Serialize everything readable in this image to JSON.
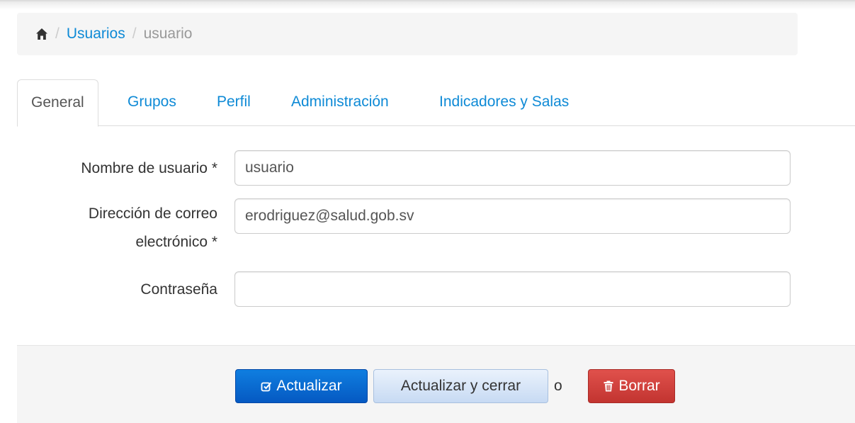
{
  "breadcrumb": {
    "home_icon": "home-icon",
    "items": [
      "Usuarios",
      "usuario"
    ],
    "separator": "/"
  },
  "tabs": [
    {
      "label": "General",
      "active": true
    },
    {
      "label": "Grupos"
    },
    {
      "label": "Perfil"
    },
    {
      "label": "Administración"
    },
    {
      "label": "Indicadores y Salas"
    }
  ],
  "form": {
    "username": {
      "label": "Nombre de usuario *",
      "value": "usuario"
    },
    "email": {
      "label_line1": "Dirección de correo",
      "label_line2": "electrónico *",
      "value": "erodriguez@salud.gob.sv"
    },
    "password": {
      "label": "Contraseña",
      "value": ""
    }
  },
  "actions": {
    "update_label": "Actualizar",
    "update_icon": "edit-check-icon",
    "update_close_label": "Actualizar y cerrar",
    "or_text": "o",
    "delete_label": "Borrar",
    "delete_icon": "trash-icon"
  },
  "colors": {
    "link": "#0e8ad6",
    "primary": "#0559c2",
    "danger": "#c23430"
  }
}
